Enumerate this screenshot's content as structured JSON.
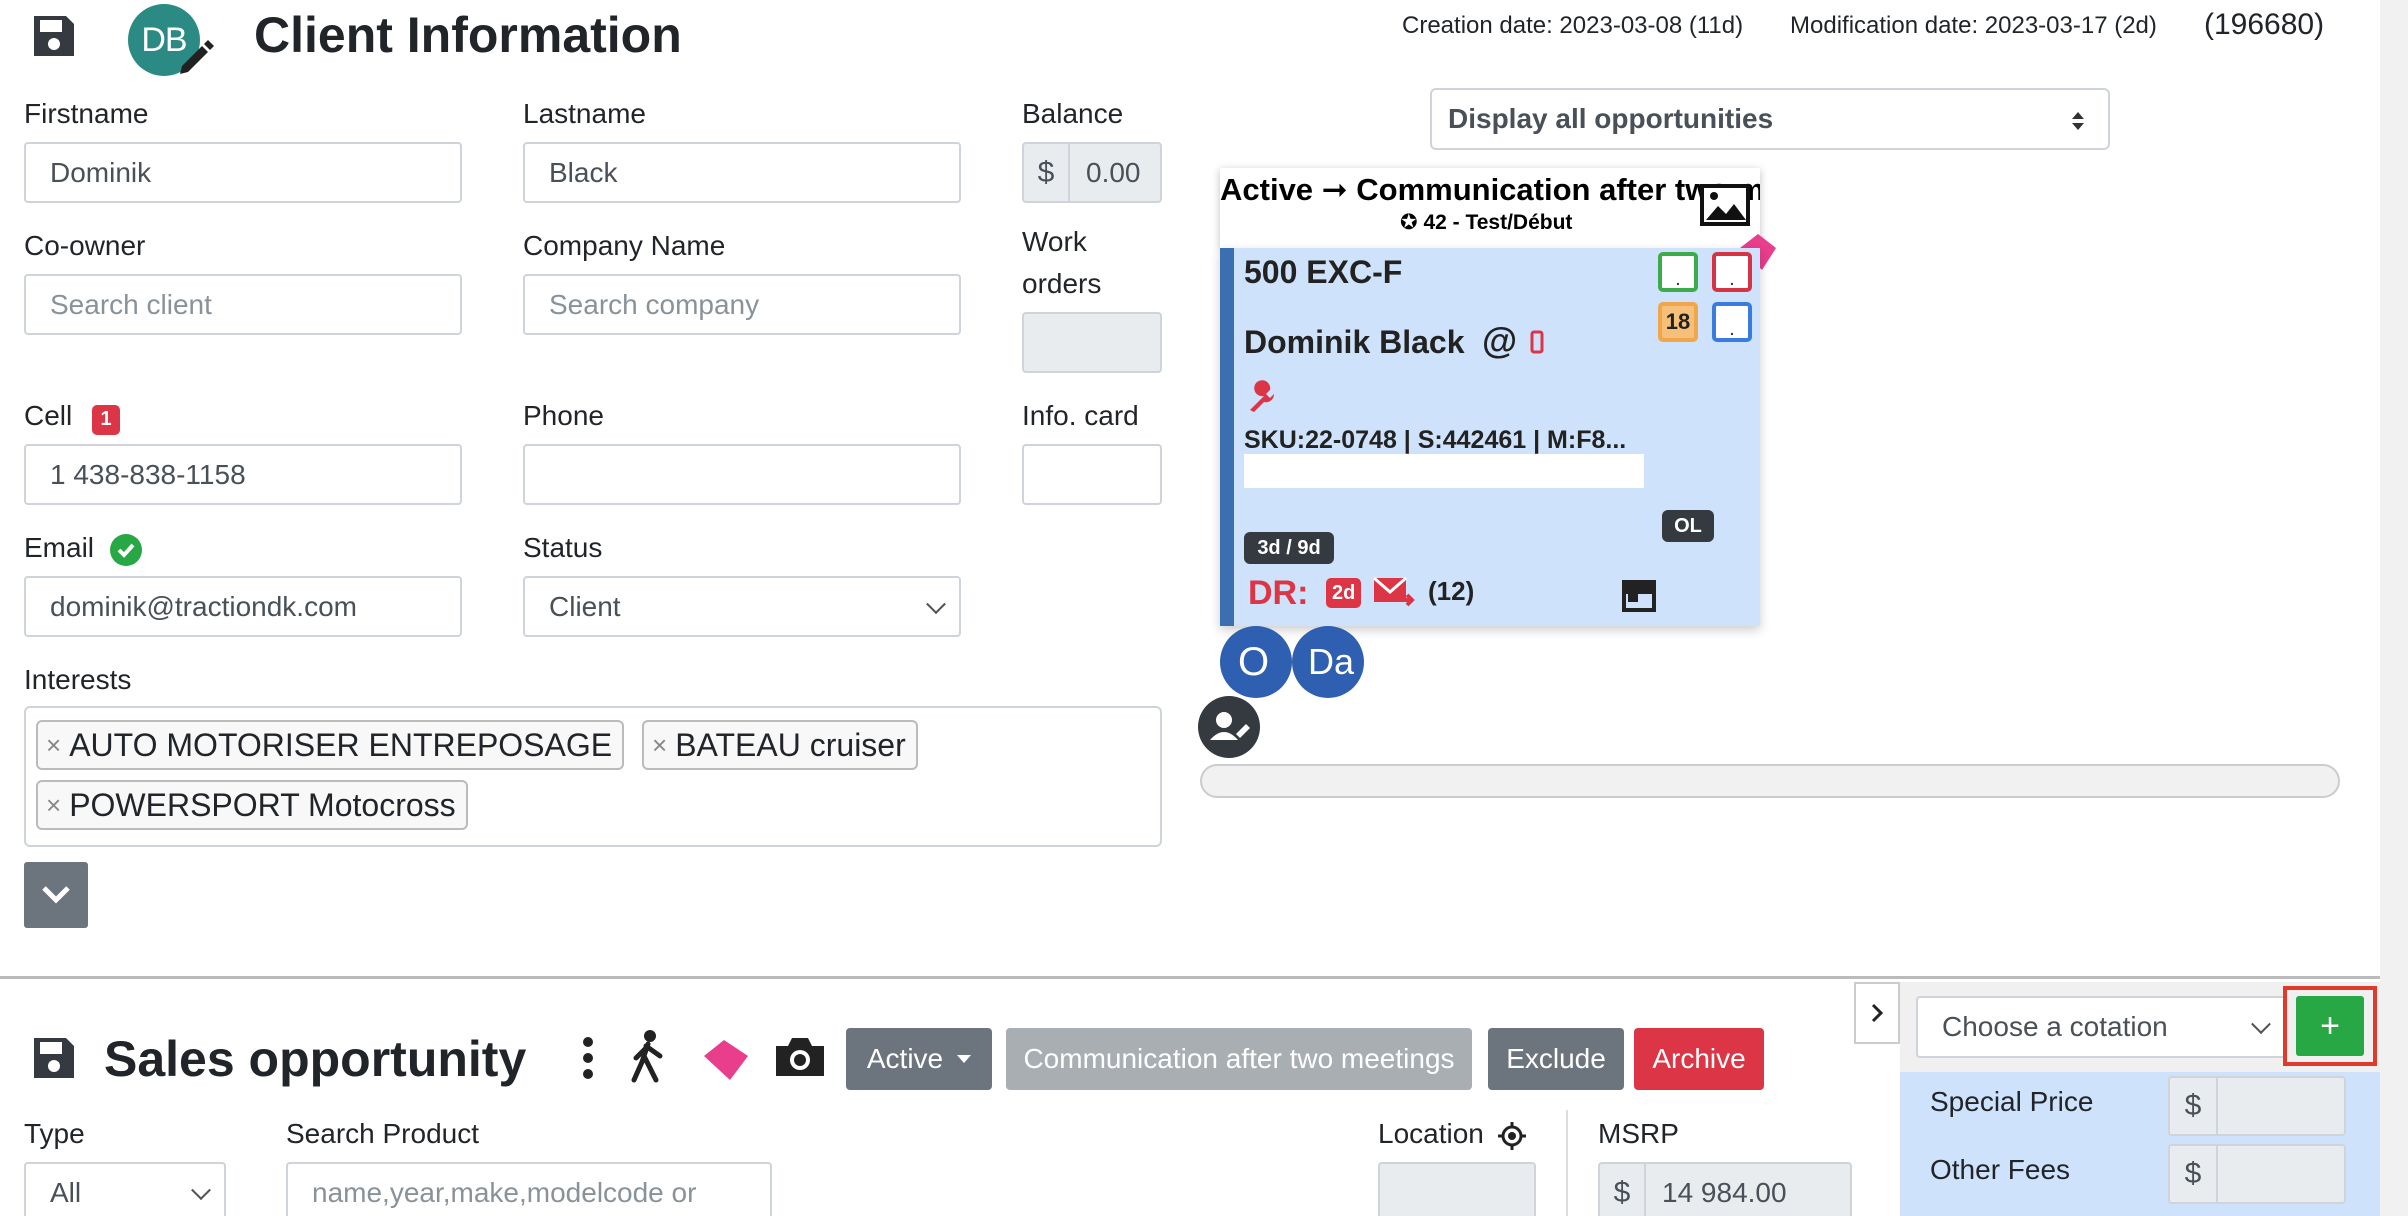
{
  "client": {
    "title": "Client Information",
    "avatar_initials": "DB",
    "creation_date": "Creation date: 2023-03-08 (11d)",
    "modification_date": "Modification date: 2023-03-17 (2d)",
    "client_id": "(196680)",
    "firstname_label": "Firstname",
    "firstname_value": "Dominik",
    "lastname_label": "Lastname",
    "lastname_value": "Black",
    "balance_label": "Balance",
    "balance_currency": "$",
    "balance_value": "0.00",
    "coowner_label": "Co-owner",
    "coowner_placeholder": "Search client",
    "company_label": "Company Name",
    "company_placeholder": "Search company",
    "work_orders_label_1": "Work",
    "work_orders_label_2": "orders",
    "cell_label": "Cell",
    "cell_badge": "1",
    "cell_value": "1 438-838-1158",
    "phone_label": "Phone",
    "phone_value": "",
    "info_card_label": "Info. card",
    "email_label": "Email",
    "email_value": "dominik@tractiondk.com",
    "status_label": "Status",
    "status_value": "Client",
    "interests_label": "Interests",
    "interests": [
      "AUTO MOTORISER ENTREPOSAGE",
      "BATEAU cruiser",
      "POWERSPORT Motocross"
    ]
  },
  "opportunities": {
    "filter_value": "Display all opportunities",
    "card": {
      "title": "Active ➞ Communication after two meetings",
      "subtitle": "42 - Test/Début",
      "product": "500 EXC-F",
      "client_name": "Dominik Black",
      "at_symbol": "@",
      "sku_line": "SKU:22-0748 | S:442461 | M:F8...",
      "calendar_number": "18",
      "calendar_dot": ".",
      "ol_badge": "OL",
      "duration_badge": "3d / 9d",
      "dr_label": "DR:",
      "dr_badge": "2d",
      "mail_count": "(12)"
    },
    "bubbles": [
      "O",
      "Da"
    ]
  },
  "sales": {
    "title": "Sales opportunity",
    "status_button": "Active",
    "step_button": "Communication after two meetings",
    "exclude_button": "Exclude",
    "archive_button": "Archive",
    "type_label": "Type",
    "type_value": "All",
    "search_product_label": "Search Product",
    "search_product_placeholder": "name,year,make,modelcode or",
    "location_label": "Location",
    "msrp_label": "MSRP",
    "msrp_currency": "$",
    "msrp_value": "14 984.00"
  },
  "cotation": {
    "select_value": "Choose a cotation",
    "add_button": "+",
    "special_price_label": "Special Price",
    "other_fees_label": "Other Fees",
    "currency": "$"
  },
  "colors": {
    "accent_green": "#28a745",
    "danger_red": "#dc3545",
    "card_blue": "#cfe2fb",
    "tag_pink": "#e83e8c"
  }
}
